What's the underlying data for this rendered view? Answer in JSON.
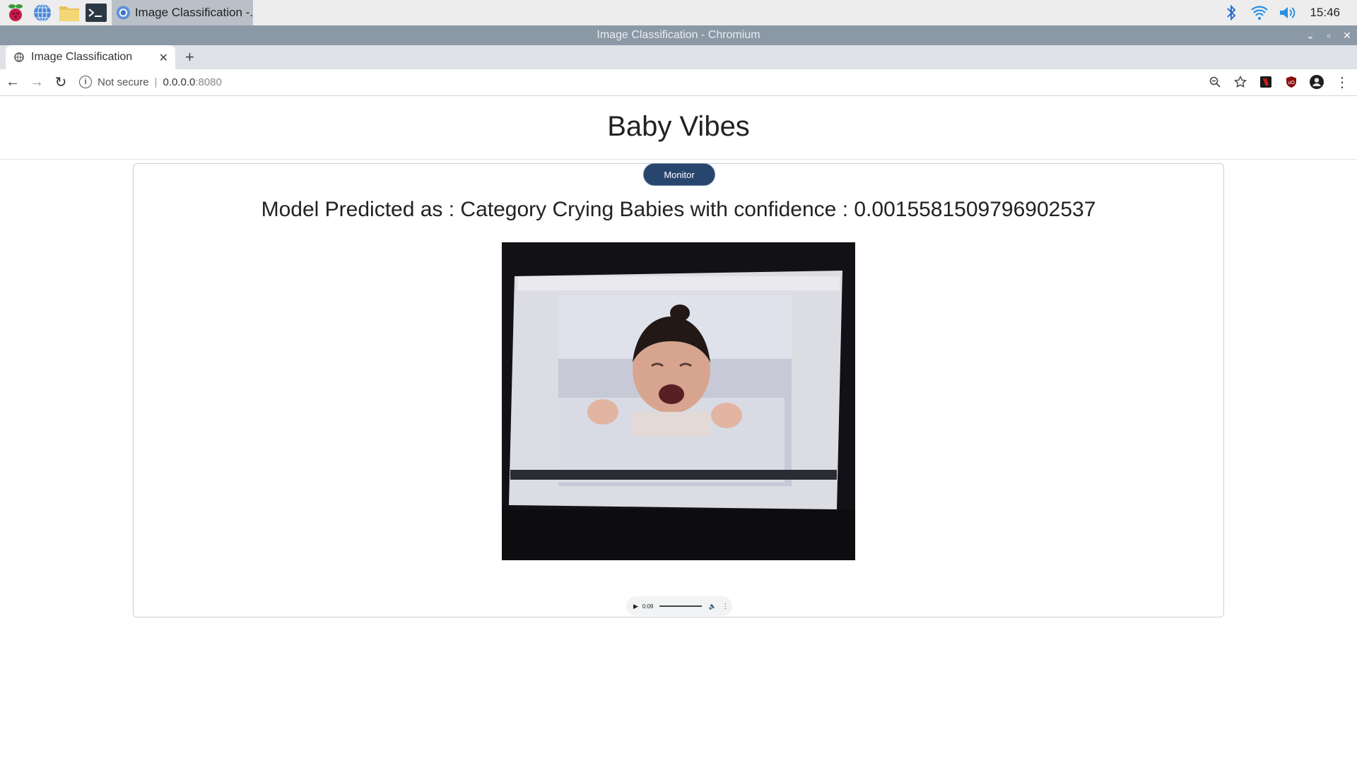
{
  "taskbar": {
    "window_label": "Image Classification -...",
    "clock": "15:46",
    "icons": [
      "raspberry-pi-menu-icon",
      "web-browser-icon",
      "file-manager-icon",
      "terminal-icon"
    ],
    "tray_icons": [
      "bluetooth-icon",
      "wifi-icon",
      "volume-icon"
    ]
  },
  "window": {
    "title": "Image Classification - Chromium",
    "controls": [
      "⌄",
      "▫",
      "✕"
    ]
  },
  "browser": {
    "tab_title": "Image Classification",
    "tab_close": "✕",
    "new_tab": "+",
    "nav": {
      "back": "←",
      "forward": "→",
      "reload": "↻"
    },
    "security_label": "Not secure",
    "separator": "|",
    "url_host": "0.0.0.0",
    "url_port": ":8080"
  },
  "page": {
    "title": "Baby Vibes",
    "monitor_button": "Monitor",
    "prediction": "Model Predicted as : Category Crying Babies with confidence : 0.0015581509796902537",
    "audio": {
      "play": "▶",
      "time": "0:09",
      "volume": "🔈",
      "more": "⋮"
    }
  },
  "colors": {
    "taskbar_bg": "#ededed",
    "titlebar_bg": "#8b98a6",
    "monitor_button_bg": "#28456e"
  }
}
